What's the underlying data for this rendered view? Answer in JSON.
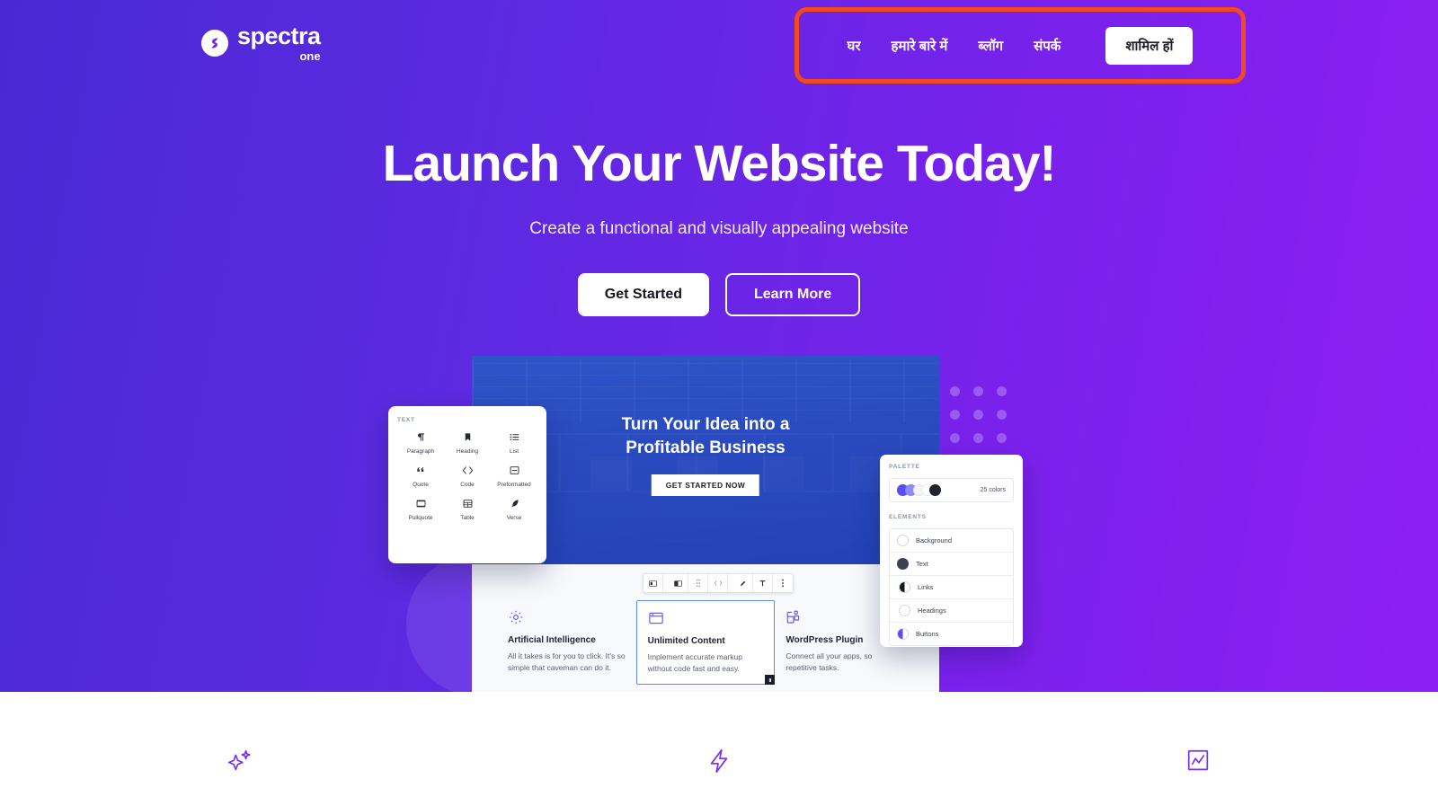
{
  "brand": {
    "name": "spectra",
    "sub": "one",
    "mark_icon": "spectra-s-logo-icon"
  },
  "nav": {
    "highlight_color": "#f4491c",
    "links": [
      {
        "label": "घर",
        "name": "nav-link-home"
      },
      {
        "label": "हमारे बारे में",
        "name": "nav-link-about"
      },
      {
        "label": "ब्लॉग",
        "name": "nav-link-blog"
      },
      {
        "label": "संपर्क",
        "name": "nav-link-contact"
      }
    ],
    "cta": "शामिल हों"
  },
  "hero": {
    "title": "Launch Your Website Today!",
    "subtitle": "Create a functional and visually appealing website",
    "primary_button": "Get Started",
    "secondary_button": "Learn More",
    "gradient_from": "#4a29d4",
    "gradient_to": "#8e1ff2"
  },
  "mockup": {
    "browser_hero": {
      "line1": "Turn Your Idea into a",
      "line2": "Profitable Business",
      "button": "GET STARTED NOW"
    },
    "features": [
      {
        "title": "Artificial Intelligence",
        "desc": "All it takes is for you to click. It's so simple that caveman can do it.",
        "icon": "gear-icon",
        "selected": false
      },
      {
        "title": "Unlimited Content",
        "desc": "Implement accurate markup without code fast and easy.",
        "icon": "browser-window-icon",
        "selected": true
      },
      {
        "title": "WordPress Plugin",
        "desc": "Connect all your apps, so repetitive tasks.",
        "icon": "plugin-blocks-icon",
        "selected": false
      }
    ],
    "block_toolbar_icons": [
      "block-type-icon",
      "align-icon",
      "drag-handle-icon",
      "inline-code-icon",
      "highlighter-icon",
      "vertical-align-icon",
      "more-options-icon"
    ],
    "text_panel": {
      "label": "TEXT",
      "blocks": [
        {
          "name": "Paragraph",
          "icon": "pilcrow-icon"
        },
        {
          "name": "Heading",
          "icon": "heading-bookmark-icon"
        },
        {
          "name": "List",
          "icon": "list-icon"
        },
        {
          "name": "Quote",
          "icon": "quote-icon"
        },
        {
          "name": "Code",
          "icon": "code-brackets-icon"
        },
        {
          "name": "Preformatted",
          "icon": "preformatted-icon"
        },
        {
          "name": "Pullquote",
          "icon": "pullquote-icon"
        },
        {
          "name": "Table",
          "icon": "table-icon"
        },
        {
          "name": "Verse",
          "icon": "quill-pen-icon"
        }
      ]
    },
    "palette_panel": {
      "palette_label": "PALETTE",
      "color_count": "25 colors",
      "swatches": [
        "#5b4df5",
        "#8e8bf8",
        "#f3f4f8",
        "#fdfdfe",
        "#20222e"
      ],
      "elements_label": "ELEMENTS",
      "elements": [
        {
          "label": "Background",
          "swatch": "#ffffff",
          "style": "outline"
        },
        {
          "label": "Text",
          "swatch": "#3c4152",
          "style": "solid"
        },
        {
          "label": "Links",
          "swatch": "#16181f",
          "style": "half"
        },
        {
          "label": "Headings",
          "swatch": "#ffffff",
          "style": "double-outline"
        },
        {
          "label": "Buttons",
          "swatch": "#5b4df5",
          "style": "half-color"
        }
      ]
    }
  },
  "bottom_icons": [
    {
      "name": "sparkles-icon",
      "color": "#7a2ff2"
    },
    {
      "name": "lightning-bolt-icon",
      "color": "#7a2ff2"
    },
    {
      "name": "chart-trend-icon",
      "color": "#7a2ff2"
    }
  ]
}
